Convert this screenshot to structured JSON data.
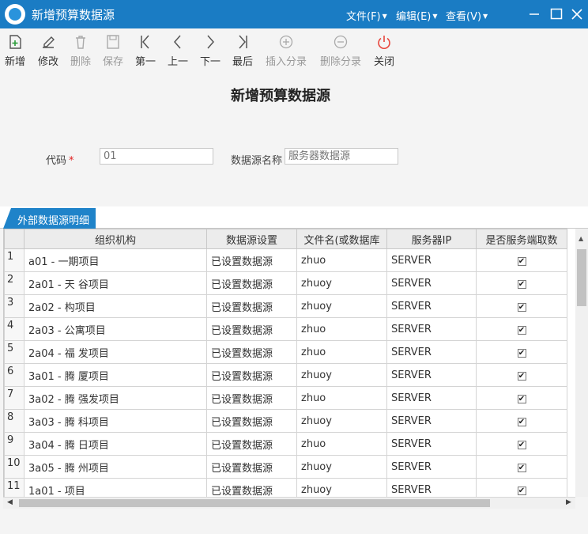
{
  "window": {
    "title": "新增预算数据源"
  },
  "menu": [
    {
      "label": "文件(F)"
    },
    {
      "label": "编辑(E)"
    },
    {
      "label": "查看(V)"
    }
  ],
  "toolbar": [
    {
      "label": "新增",
      "icon": "add-page-icon",
      "enabled": true
    },
    {
      "label": "修改",
      "icon": "edit-icon",
      "enabled": true
    },
    {
      "label": "删除",
      "icon": "trash-icon",
      "enabled": false
    },
    {
      "label": "保存",
      "icon": "save-icon",
      "enabled": false
    },
    {
      "label": "第一",
      "icon": "first-icon",
      "enabled": true
    },
    {
      "label": "上一",
      "icon": "prev-icon",
      "enabled": true
    },
    {
      "label": "下一",
      "icon": "next-icon",
      "enabled": true
    },
    {
      "label": "最后",
      "icon": "last-icon",
      "enabled": true
    },
    {
      "label": "插入分录",
      "icon": "plus-circle-icon",
      "enabled": false
    },
    {
      "label": "删除分录",
      "icon": "minus-circle-icon",
      "enabled": false
    },
    {
      "label": "关闭",
      "icon": "power-icon",
      "enabled": true
    }
  ],
  "form": {
    "title": "新增预算数据源",
    "code_label": "代码",
    "code_required": "*",
    "code_value": "01",
    "name_label": "数据源名称",
    "name_placeholder": "服务器数据源"
  },
  "tab": {
    "label": "外部数据源明细"
  },
  "grid": {
    "columns": [
      "组织机构",
      "数据源设置",
      "文件名(或数据库",
      "服务器IP",
      "是否服务端取数"
    ],
    "rows": [
      {
        "num": "1",
        "org": "a01 - 一期项目",
        "setting": "已设置数据源",
        "file": "zhuo",
        "ip": "SERVER",
        "checked": "✔"
      },
      {
        "num": "2",
        "org": "2a01 - 天 谷项目",
        "setting": "已设置数据源",
        "file": "zhuoy",
        "ip": "SERVER",
        "checked": "✔"
      },
      {
        "num": "3",
        "org": "2a02 - 构项目",
        "setting": "已设置数据源",
        "file": "zhuoy",
        "ip": "SERVER",
        "checked": "✔"
      },
      {
        "num": "4",
        "org": "2a03 - 公寓项目",
        "setting": "已设置数据源",
        "file": "zhuo",
        "ip": "SERVER",
        "checked": "✔"
      },
      {
        "num": "5",
        "org": "2a04 - 福 发项目",
        "setting": "已设置数据源",
        "file": "zhuo",
        "ip": "SERVER",
        "checked": "✔"
      },
      {
        "num": "6",
        "org": "3a01 - 腾 厦项目",
        "setting": "已设置数据源",
        "file": "zhuoy",
        "ip": "SERVER",
        "checked": "✔"
      },
      {
        "num": "7",
        "org": "3a02 - 腾 强发项目",
        "setting": "已设置数据源",
        "file": "zhuo",
        "ip": "SERVER",
        "checked": "✔"
      },
      {
        "num": "8",
        "org": "3a03 - 腾 科项目",
        "setting": "已设置数据源",
        "file": "zhuoy",
        "ip": "SERVER",
        "checked": "✔"
      },
      {
        "num": "9",
        "org": "3a04 - 腾 日项目",
        "setting": "已设置数据源",
        "file": "zhuo",
        "ip": "SERVER",
        "checked": "✔"
      },
      {
        "num": "10",
        "org": "3a05 - 腾 州项目",
        "setting": "已设置数据源",
        "file": "zhuoy",
        "ip": "SERVER",
        "checked": "✔"
      },
      {
        "num": "11",
        "org": "1a01 - 项目",
        "setting": "已设置数据源",
        "file": "zhuoy",
        "ip": "SERVER",
        "checked": "✔"
      }
    ]
  },
  "colors": {
    "titlebar": "#1a7cc4",
    "tab": "#1f83c9",
    "required": "#e02020",
    "close_icon": "#e8453c"
  }
}
